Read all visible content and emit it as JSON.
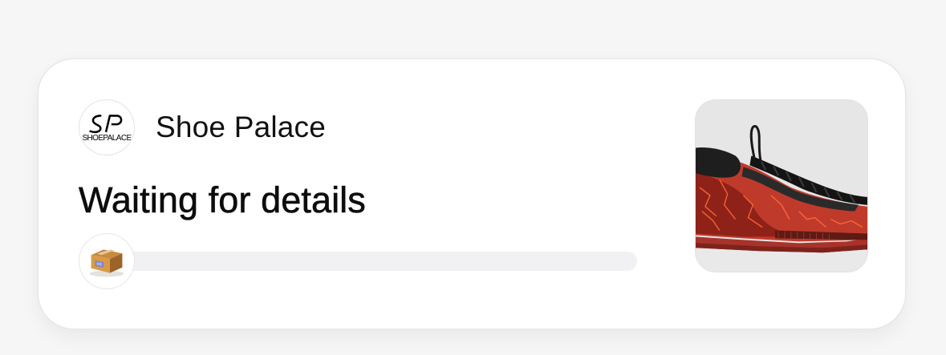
{
  "merchant": {
    "name": "Shoe Palace",
    "logo_monogram": "SP",
    "logo_wordmark": "SHOEPALACE",
    "logo_icon": "shoe-palace-logo-icon"
  },
  "order": {
    "status": "Waiting for details",
    "progress": 0.0,
    "progress_icon": "package-box-icon"
  },
  "product": {
    "image_icon": "sneaker-image-icon"
  },
  "colors": {
    "background": "#f6f6f7",
    "card": "#ffffff",
    "track": "#f1f1f3",
    "text": "#111111"
  }
}
